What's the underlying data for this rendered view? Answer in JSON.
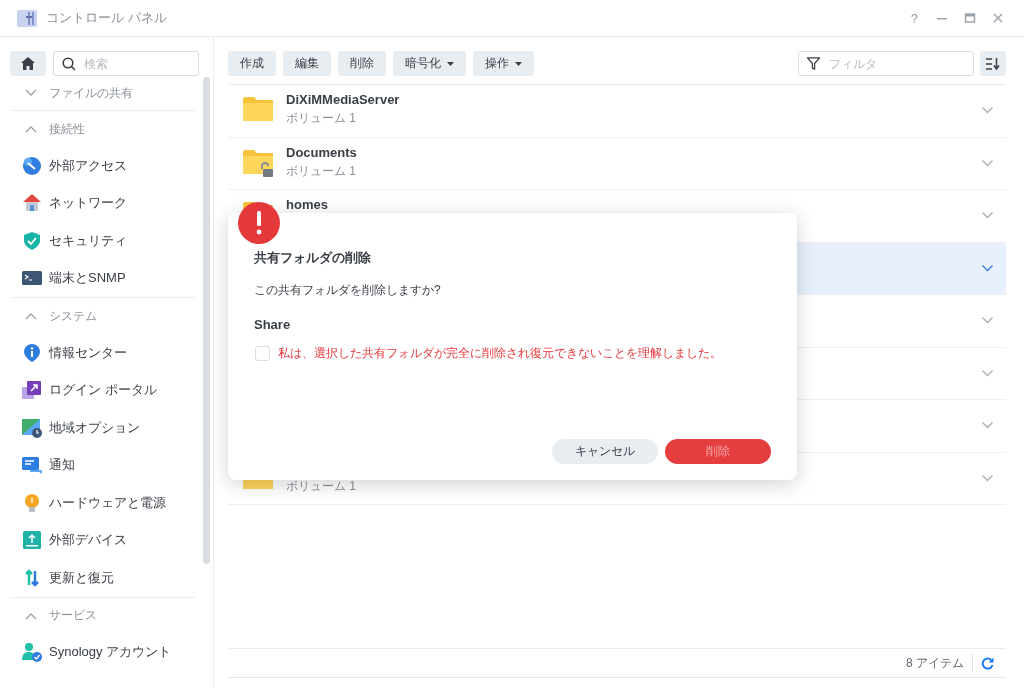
{
  "window": {
    "title": "コントロール パネル",
    "help": "?"
  },
  "sidebar": {
    "search": {
      "placeholder": "検索"
    },
    "sections": [
      {
        "title": "ファイルの共有",
        "expanded": false
      },
      {
        "title": "接続性",
        "expanded": true,
        "items": [
          {
            "label": "外部アクセス",
            "kind": "link"
          },
          {
            "label": "ネットワーク",
            "kind": "house"
          },
          {
            "label": "セキュリティ",
            "kind": "shield"
          },
          {
            "label": "端末とSNMP",
            "kind": "terminal"
          }
        ]
      },
      {
        "title": "システム",
        "expanded": true,
        "items": [
          {
            "label": "情報センター",
            "kind": "info"
          },
          {
            "label": "ログイン ポータル",
            "kind": "portal"
          },
          {
            "label": "地域オプション",
            "kind": "region"
          },
          {
            "label": "通知",
            "kind": "chat"
          },
          {
            "label": "ハードウェアと電源",
            "kind": "bulb"
          },
          {
            "label": "外部デバイス",
            "kind": "device"
          },
          {
            "label": "更新と復元",
            "kind": "update"
          }
        ]
      },
      {
        "title": "サービス",
        "expanded": true,
        "items": [
          {
            "label": "Synology アカウント",
            "kind": "account"
          }
        ]
      }
    ]
  },
  "toolbar": {
    "buttons": [
      {
        "label": "作成",
        "dropdown": false
      },
      {
        "label": "編集",
        "dropdown": false
      },
      {
        "label": "削除",
        "dropdown": false
      },
      {
        "label": "暗号化",
        "dropdown": true
      },
      {
        "label": "操作",
        "dropdown": true
      }
    ],
    "filter": {
      "placeholder": "フィルタ"
    }
  },
  "list": {
    "rows": [
      {
        "name": "DiXiMMediaServer",
        "volume": "ボリューム 1",
        "encrypted": false,
        "selected": false
      },
      {
        "name": "Documents",
        "volume": "ボリューム 1",
        "encrypted": true,
        "selected": false
      },
      {
        "name": "homes",
        "selected": false
      },
      {
        "selected": true
      },
      {
        "selected": false
      },
      {
        "selected": false
      },
      {
        "selected": false
      },
      {
        "volume": "ボリューム 1",
        "selected": false
      }
    ]
  },
  "status_bar": {
    "count": "8 アイテム"
  },
  "dialog": {
    "title": "共有フォルダの削除",
    "message": "この共有フォルダを削除しますか?",
    "folder": "Share",
    "confirm": {
      "label": "私は、選択した共有フォルダが完全に削除され復元できないことを理解しました。",
      "checked": false
    },
    "buttons": [
      {
        "label": "キャンセル",
        "kind": "secondary",
        "disabled": false
      },
      {
        "label": "削除",
        "kind": "danger",
        "disabled": true
      }
    ]
  }
}
